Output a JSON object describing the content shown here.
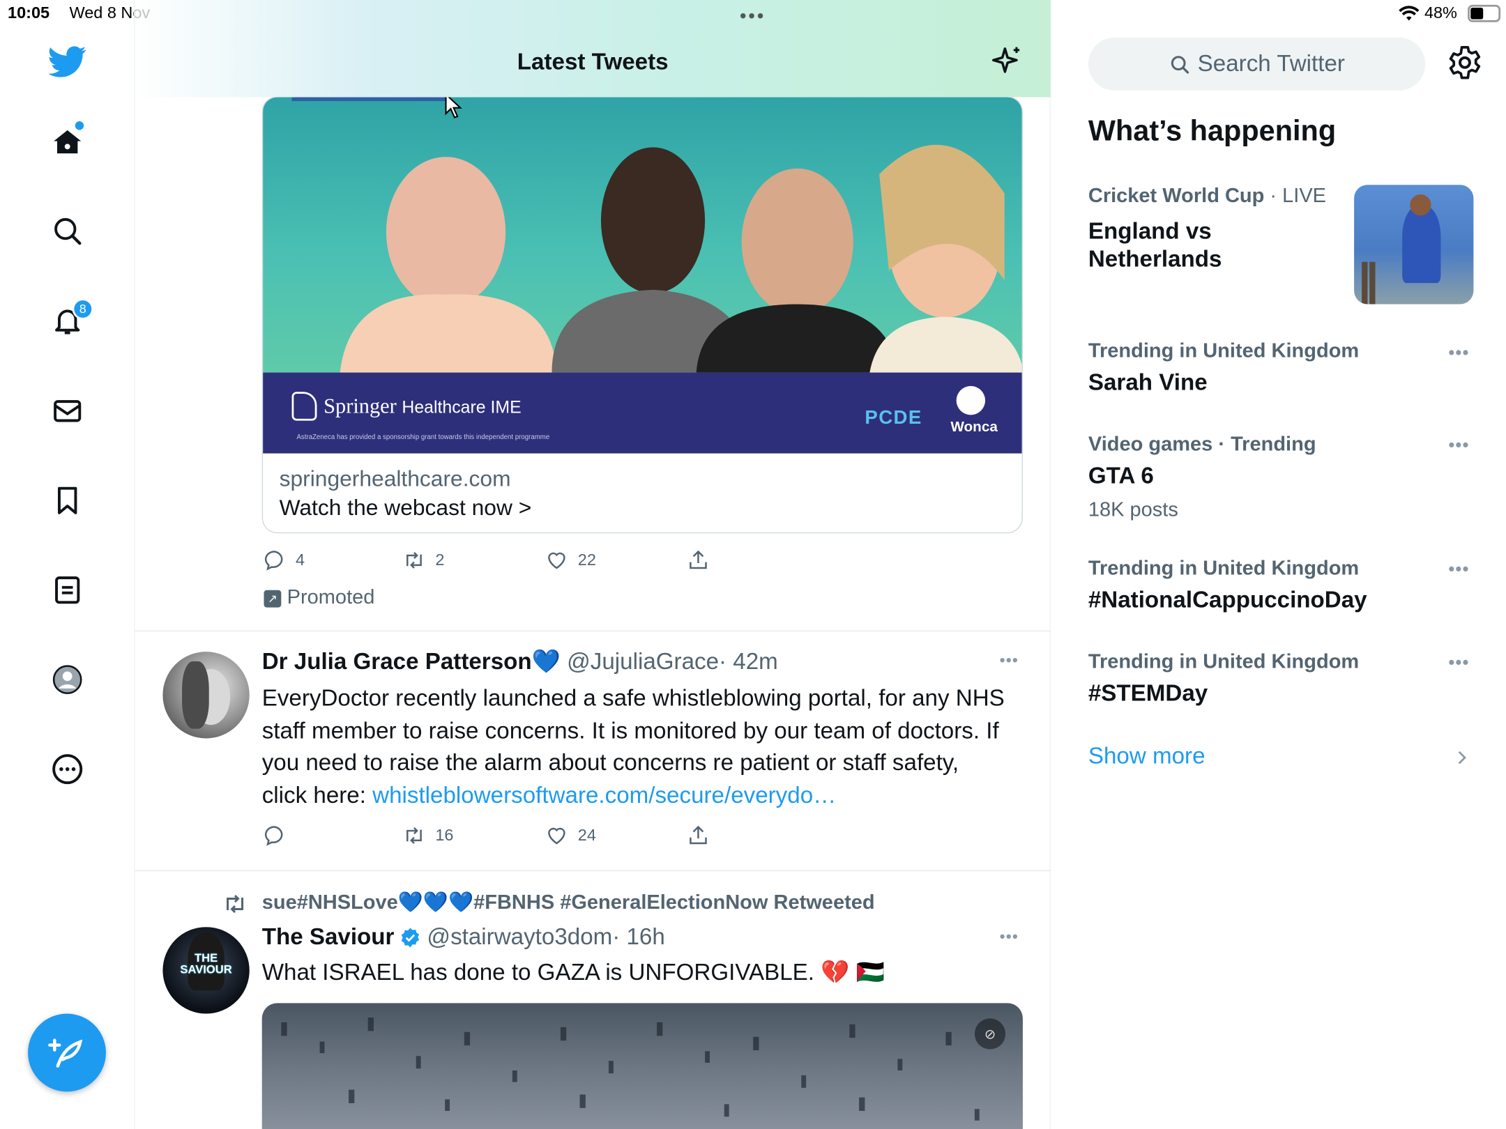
{
  "status_bar": {
    "time": "10:05",
    "date": "Wed 8 Nov",
    "battery": "48%"
  },
  "header": {
    "title": "Latest Tweets"
  },
  "nav": {
    "notifications_badge": "8"
  },
  "promo": {
    "banner_brand": "Springer",
    "banner_brand_suffix": "Healthcare IME",
    "banner_disclaimer": "AstraZeneca has provided a sponsorship grant towards this independent programme",
    "banner_logo1": "PCDE",
    "banner_logo2": "Wonca",
    "domain": "springerhealthcare.com",
    "cta": "Watch the webcast now >",
    "replies": "4",
    "retweets": "2",
    "likes": "22",
    "promoted_label": "Promoted"
  },
  "tweet1": {
    "name": "Dr Julia Grace Patterson💙",
    "handle": "@JujuliaGrace",
    "time": "· 42m",
    "text": "EveryDoctor recently launched a safe whistleblowing portal, for any NHS staff member to raise concerns. It is monitored by our team of doctors. If you need to raise the alarm about concerns re patient or staff safety, click here: ",
    "link": "whistleblowersoftware.com/secure/everydo…",
    "replies": "",
    "retweets": "16",
    "likes": "24"
  },
  "tweet2": {
    "retweeted_by": "sue#NHSLove💙💙💙#FBNHS #GeneralElectionNow Retweeted",
    "name": "The Saviour",
    "handle": "@stairwayto3dom",
    "time": "· 16h",
    "text": "What ISRAEL has done to GAZA is UNFORGIVABLE. 💔 🇵🇸",
    "avatar_text": "THE SAVIOUR"
  },
  "sidebar": {
    "search_placeholder": "Search Twitter",
    "heading": "What’s happening",
    "trends": [
      {
        "category": "Cricket World Cup",
        "category_suffix": " · LIVE",
        "title": "England vs Netherlands"
      },
      {
        "category": "Trending in United Kingdom",
        "title": "Sarah Vine"
      },
      {
        "category": "Video games · Trending",
        "title": "GTA 6",
        "count": "18K posts"
      },
      {
        "category": "Trending in United Kingdom",
        "title": "#NationalCappuccinoDay"
      },
      {
        "category": "Trending in United Kingdom",
        "title": "#STEMDay"
      }
    ],
    "show_more": "Show more"
  },
  "colors": {
    "accent": "#1d9bf0",
    "text": "#0f1419",
    "muted": "#536471",
    "banner": "#2e2f7a"
  }
}
